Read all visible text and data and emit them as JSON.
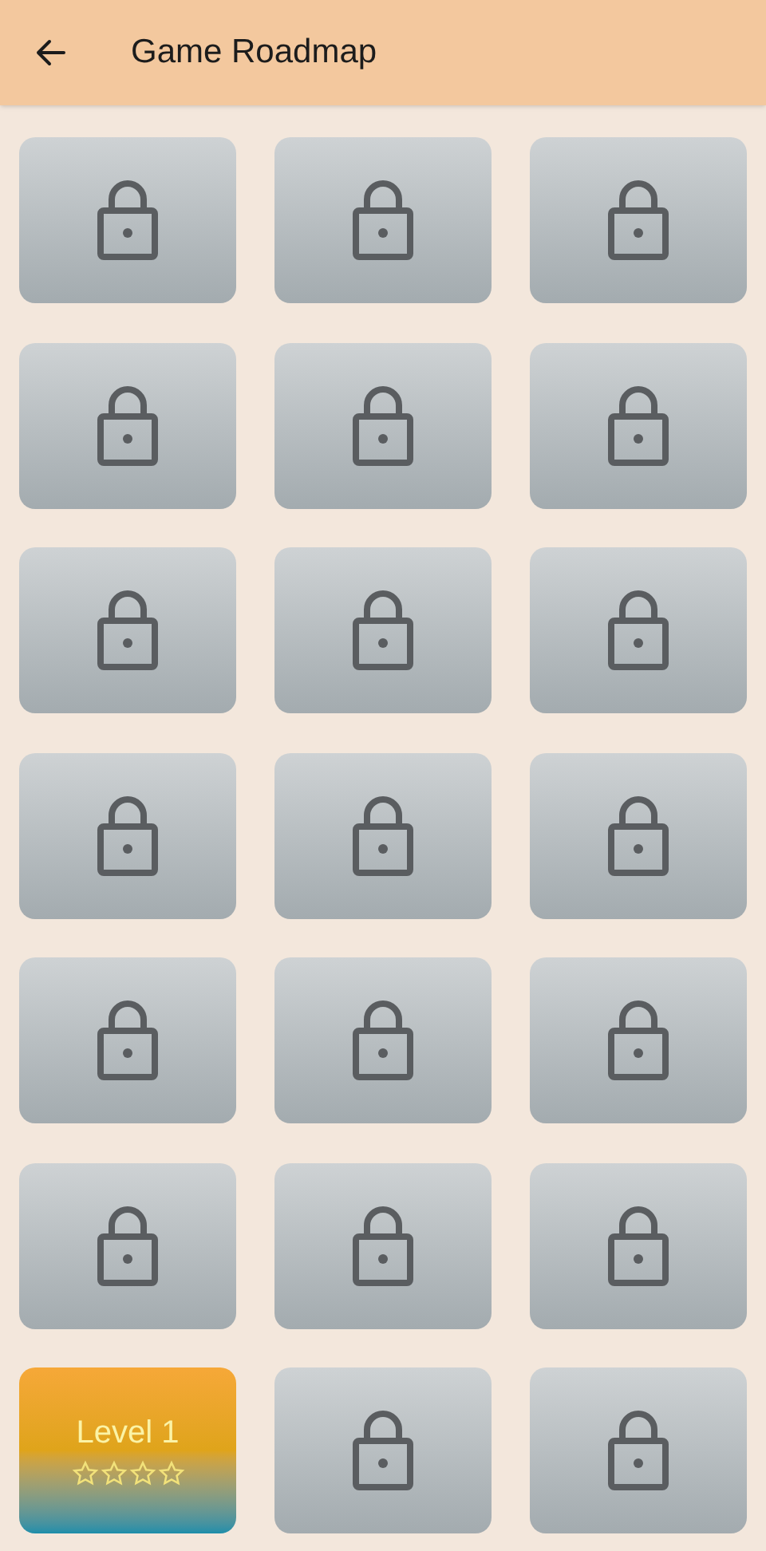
{
  "header": {
    "title": "Game Roadmap"
  },
  "tiles": [
    {
      "kind": "locked"
    },
    {
      "kind": "locked"
    },
    {
      "kind": "locked"
    },
    {
      "kind": "locked"
    },
    {
      "kind": "locked"
    },
    {
      "kind": "locked"
    },
    {
      "kind": "locked"
    },
    {
      "kind": "locked"
    },
    {
      "kind": "locked"
    },
    {
      "kind": "locked"
    },
    {
      "kind": "locked"
    },
    {
      "kind": "locked"
    },
    {
      "kind": "locked"
    },
    {
      "kind": "locked"
    },
    {
      "kind": "locked"
    },
    {
      "kind": "locked"
    },
    {
      "kind": "locked"
    },
    {
      "kind": "locked"
    },
    {
      "kind": "level",
      "label": "Level 1",
      "stars": 0
    },
    {
      "kind": "locked"
    },
    {
      "kind": "locked"
    }
  ]
}
